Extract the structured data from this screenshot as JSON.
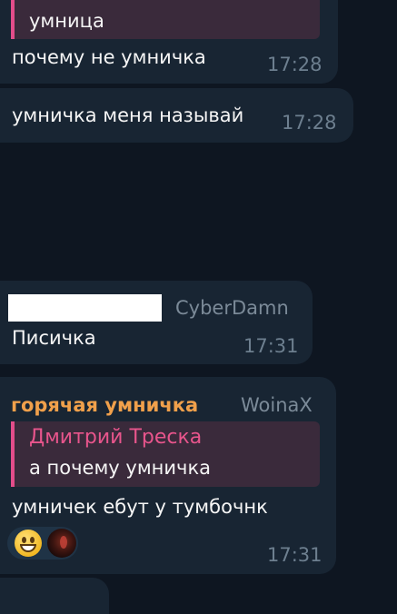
{
  "messages": [
    {
      "reply_text": "умница",
      "text": "почему не умничка",
      "time": "17:28"
    },
    {
      "text": "умничка меня называй",
      "time": "17:28"
    },
    {
      "admin_tag": "CyberDamn",
      "text": "Писичка",
      "time": "17:31"
    },
    {
      "sender": "горячая умничка",
      "sender_color": "#f0a04b",
      "admin_tag": "WoinaX",
      "reply_author": "Дмитрий Треска",
      "reply_text": "а почему умничка",
      "text": "умничек ебут у тумбочнк",
      "reactions": [
        {
          "icon": "grinning-face-emoji"
        },
        {
          "icon": "user-avatar"
        }
      ],
      "time": "17:31"
    }
  ],
  "colors": {
    "background": "#0e1621",
    "bubble": "#182533",
    "reply_accent": "#e24d8a",
    "timestamp": "#6d7f8f"
  }
}
